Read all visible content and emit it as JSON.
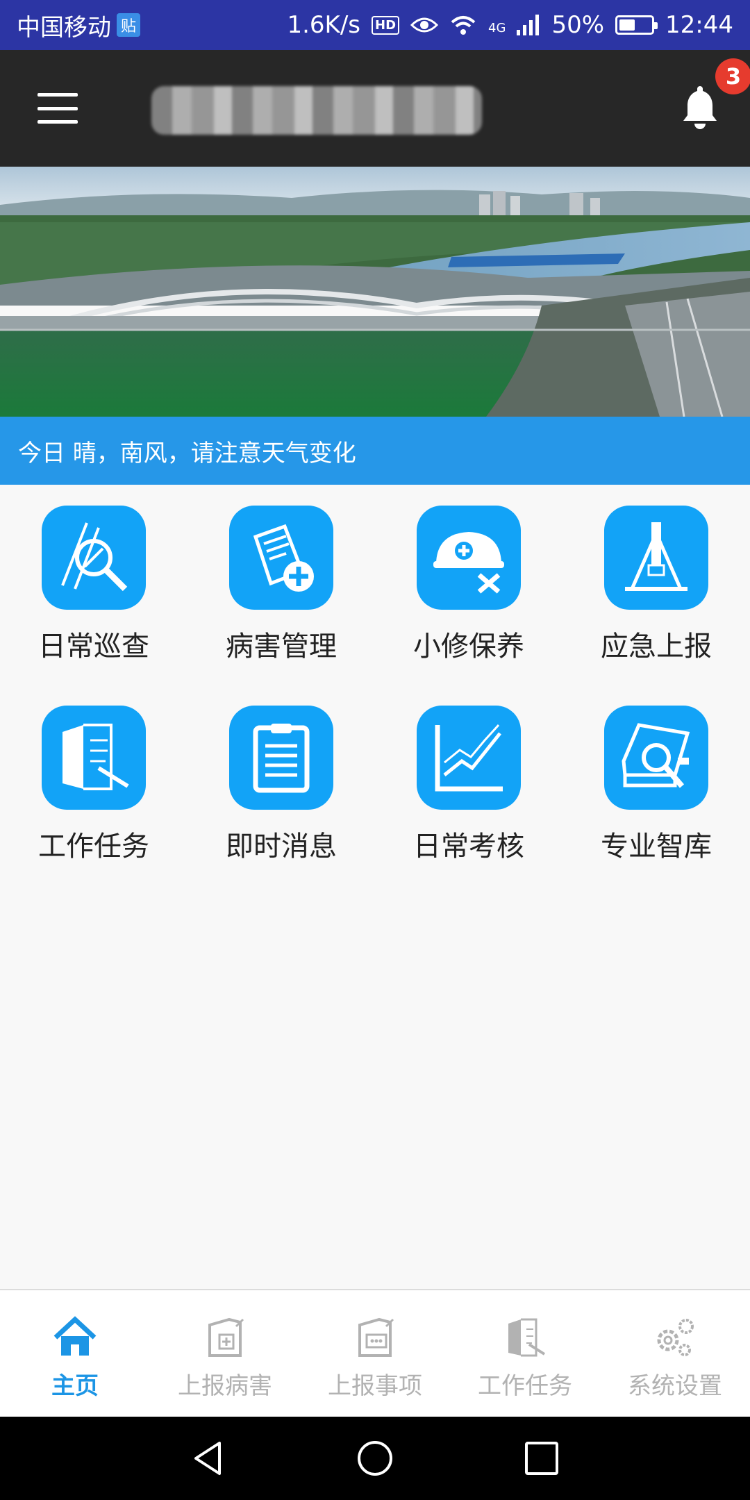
{
  "status_bar": {
    "carrier": "中国移动",
    "tieba_glyph": "贴",
    "speed": "1.6K/s",
    "hd": "HD",
    "network": "4G",
    "battery_percent": "50%",
    "battery_level": 0.5,
    "time": "12:44"
  },
  "app_bar": {
    "notification_count": "3",
    "title_redacted": true
  },
  "banner": {
    "weather_text": "今日 晴，南风，请注意天气变化"
  },
  "menu": [
    {
      "label": "日常巡查",
      "icon": "patrol-search-icon"
    },
    {
      "label": "病害管理",
      "icon": "damage-document-add-icon"
    },
    {
      "label": "小修保养",
      "icon": "helmet-wrench-icon"
    },
    {
      "label": "应急上报",
      "icon": "emergency-pole-icon"
    },
    {
      "label": "工作任务",
      "icon": "task-book-icon"
    },
    {
      "label": "即时消息",
      "icon": "clipboard-message-icon"
    },
    {
      "label": "日常考核",
      "icon": "line-chart-icon"
    },
    {
      "label": "专业智库",
      "icon": "library-search-icon"
    }
  ],
  "tabs": [
    {
      "label": "主页",
      "icon": "home-icon",
      "active": true
    },
    {
      "label": "上报病害",
      "icon": "report-damage-icon",
      "active": false
    },
    {
      "label": "上报事项",
      "icon": "report-item-icon",
      "active": false
    },
    {
      "label": "工作任务",
      "icon": "task-icon",
      "active": false
    },
    {
      "label": "系统设置",
      "icon": "settings-gears-icon",
      "active": false
    }
  ],
  "colors": {
    "status_bar": "#2c35a4",
    "app_bar": "#272727",
    "accent_blue": "#12a3f7",
    "weather_bar": "#2697e8",
    "tab_active": "#1c95e5",
    "badge": "#e63b2e"
  }
}
